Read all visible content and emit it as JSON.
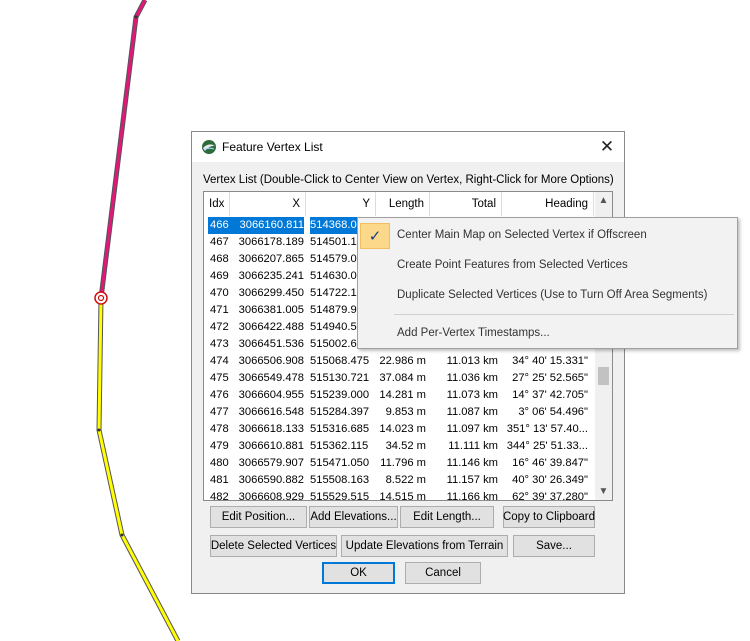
{
  "dialog": {
    "title": "Feature Vertex List",
    "close_symbol": "✕",
    "list_label": "Vertex List (Double-Click to Center View on Vertex, Right-Click for More Options)"
  },
  "columns": [
    "Idx",
    "X",
    "Y",
    "Length",
    "Total Length",
    "Heading"
  ],
  "rows": [
    {
      "idx": "466",
      "x": "3066160.811",
      "y": "514368.0",
      "len": "",
      "tot": "",
      "head": "",
      "selected": true
    },
    {
      "idx": "467",
      "x": "3066178.189",
      "y": "514501.1",
      "len": "",
      "tot": "",
      "head": ""
    },
    {
      "idx": "468",
      "x": "3066207.865",
      "y": "514579.0",
      "len": "",
      "tot": "",
      "head": ""
    },
    {
      "idx": "469",
      "x": "3066235.241",
      "y": "514630.0",
      "len": "",
      "tot": "",
      "head": ""
    },
    {
      "idx": "470",
      "x": "3066299.450",
      "y": "514722.1",
      "len": "",
      "tot": "",
      "head": ""
    },
    {
      "idx": "471",
      "x": "3066381.005",
      "y": "514879.9",
      "len": "",
      "tot": "",
      "head": ""
    },
    {
      "idx": "472",
      "x": "3066422.488",
      "y": "514940.5",
      "len": "",
      "tot": "",
      "head": ""
    },
    {
      "idx": "473",
      "x": "3066451.536",
      "y": "515002.6",
      "len": "",
      "tot": "",
      "head": ""
    },
    {
      "idx": "474",
      "x": "3066506.908",
      "y": "515068.475",
      "len": "22.986 m",
      "tot": "11.013 km",
      "head": "34° 40' 15.331\""
    },
    {
      "idx": "475",
      "x": "3066549.478",
      "y": "515130.721",
      "len": "37.084 m",
      "tot": "11.036 km",
      "head": "27° 25' 52.565\""
    },
    {
      "idx": "476",
      "x": "3066604.955",
      "y": "515239.000",
      "len": "14.281 m",
      "tot": "11.073 km",
      "head": "14° 37' 42.705\""
    },
    {
      "idx": "477",
      "x": "3066616.548",
      "y": "515284.397",
      "len": "9.853 m",
      "tot": "11.087 km",
      "head": "3° 06' 54.496\""
    },
    {
      "idx": "478",
      "x": "3066618.133",
      "y": "515316.685",
      "len": "14.023 m",
      "tot": "11.097 km",
      "head": "351° 13' 57.40..."
    },
    {
      "idx": "479",
      "x": "3066610.881",
      "y": "515362.115",
      "len": "34.52 m",
      "tot": "11.111 km",
      "head": "344° 25' 51.33..."
    },
    {
      "idx": "480",
      "x": "3066579.907",
      "y": "515471.050",
      "len": "11.796 m",
      "tot": "11.146 km",
      "head": "16° 46' 39.847\""
    },
    {
      "idx": "481",
      "x": "3066590.882",
      "y": "515508.163",
      "len": "8.522 m",
      "tot": "11.157 km",
      "head": "40° 30' 26.349\""
    },
    {
      "idx": "482",
      "x": "3066608.929",
      "y": "515529.515",
      "len": "14.515 m",
      "tot": "11.166 km",
      "head": "62° 39' 37.280\""
    }
  ],
  "buttons": {
    "edit_position": "Edit Position...",
    "add_elevations": "Add Elevations...",
    "edit_length": "Edit Length...",
    "copy_clipboard": "Copy to Clipboard",
    "delete_selected": "Delete Selected Vertices",
    "update_elevations": "Update Elevations from Terrain",
    "save": "Save...",
    "ok": "OK",
    "cancel": "Cancel"
  },
  "context_menu": {
    "items": [
      {
        "label": "Center Main Map on Selected Vertex if Offscreen",
        "checked": true
      },
      {
        "label": "Create Point Features from Selected Vertices"
      },
      {
        "label": "Duplicate Selected Vertices (Use to Turn Off Area Segments)"
      },
      {
        "label": "Add Per-Vertex Timestamps..."
      }
    ],
    "check_symbol": "✓"
  },
  "scrollbar": {
    "up_arrow": "▲",
    "down_arrow": "▼"
  },
  "colors": {
    "selected_row": "#0078d7",
    "map_line_upper": "#e0187a",
    "map_line_lower": "#ffff00",
    "menu_check_bg": "#fcd98a"
  }
}
